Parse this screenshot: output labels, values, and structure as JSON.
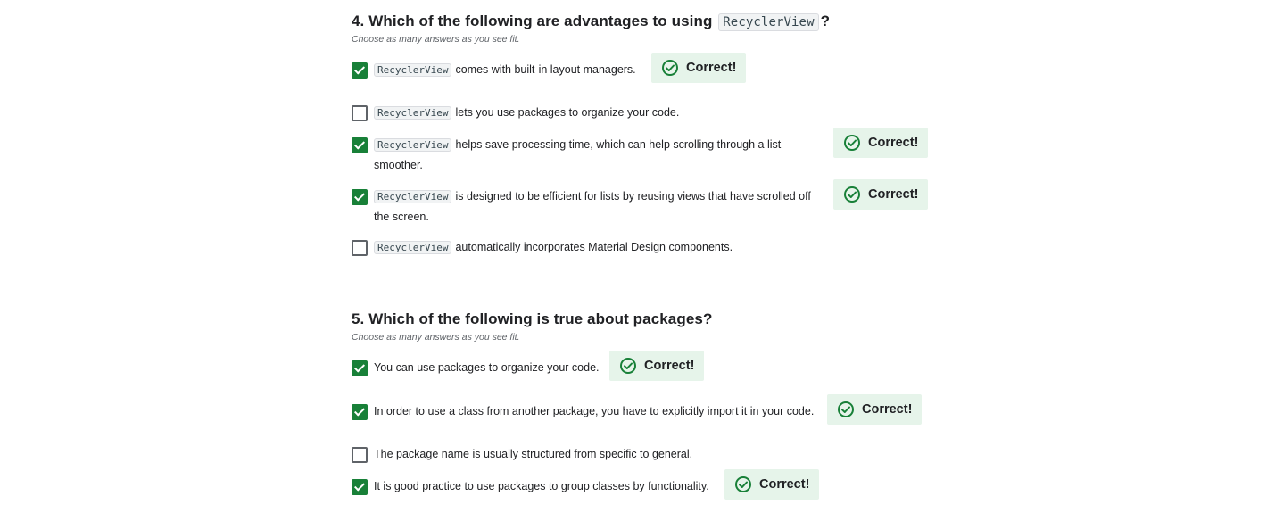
{
  "q4": {
    "title_prefix": "4. Which of the following are advantages to using ",
    "title_code": "RecyclerView",
    "title_suffix": "?",
    "hint": "Choose as many answers as you see fit.",
    "options": [
      {
        "code": "RecyclerView",
        "text": "comes with built-in layout managers.",
        "checked": true,
        "feedback": "Correct!"
      },
      {
        "code": "RecyclerView",
        "text": "lets you use packages to organize your code.",
        "checked": false
      },
      {
        "code": "RecyclerView",
        "text": "helps save processing time, which can help scrolling through a list smoother.",
        "checked": true,
        "feedback": "Correct!"
      },
      {
        "code": "RecyclerView",
        "text": "is designed to be efficient for lists by reusing views that have scrolled off the screen.",
        "checked": true,
        "feedback": "Correct!"
      },
      {
        "code": "RecyclerView",
        "text": "automatically incorporates Material Design components.",
        "checked": false
      }
    ]
  },
  "q5": {
    "title": "5. Which of the following is true about packages?",
    "hint": "Choose as many answers as you see fit.",
    "options": [
      {
        "text": "You can use packages to organize your code.",
        "checked": true,
        "feedback": "Correct!"
      },
      {
        "text": "In order to use a class from another package, you have to explicitly import it in your code.",
        "checked": true,
        "feedback": "Correct!"
      },
      {
        "text": "The package name is usually structured from specific to general.",
        "checked": false
      },
      {
        "text": "It is good practice to use packages to group classes by functionality.",
        "checked": true,
        "feedback": "Correct!"
      }
    ]
  },
  "colors": {
    "accent_green": "#188038",
    "feedback_bg": "#e6f4ea"
  },
  "icons": {
    "feedback": "check-circle-icon"
  }
}
